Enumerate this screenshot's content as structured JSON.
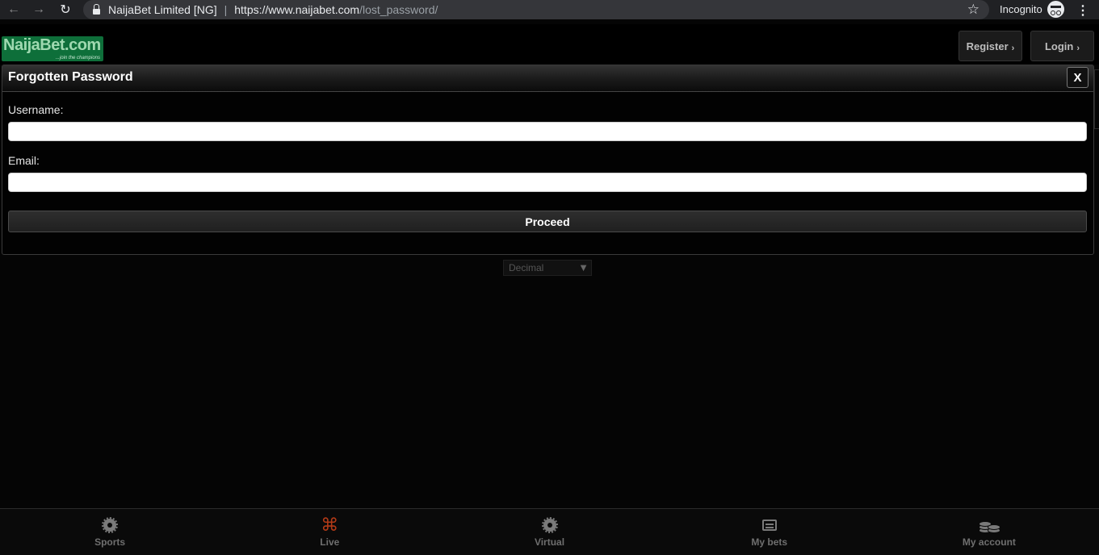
{
  "browser": {
    "site_name": "NaijaBet Limited [NG]",
    "url_host": "https://www.naijabet.com",
    "url_path": "/lost_password/",
    "incognito_label": "Incognito"
  },
  "header": {
    "logo_text": "NaijaBet.com",
    "logo_tagline": "...join the champions",
    "register_label": "Register",
    "login_label": "Login"
  },
  "modal": {
    "title": "Forgotten Password",
    "close_label": "X",
    "username_label": "Username:",
    "username_value": "",
    "email_label": "Email:",
    "email_value": "",
    "proceed_label": "Proceed"
  },
  "odds_format": {
    "selected": "Decimal"
  },
  "bottom_nav": {
    "items": [
      {
        "label": "Sports",
        "icon": "soccer-ball-icon"
      },
      {
        "label": "Live",
        "icon": "live-signal-icon"
      },
      {
        "label": "Virtual",
        "icon": "soccer-ball-icon"
      },
      {
        "label": "My bets",
        "icon": "bet-slip-icon"
      },
      {
        "label": "My account",
        "icon": "coins-icon"
      }
    ]
  },
  "colors": {
    "background": "#050505",
    "live_accent": "#b23a17",
    "logo_green": "#0e6f3a"
  }
}
